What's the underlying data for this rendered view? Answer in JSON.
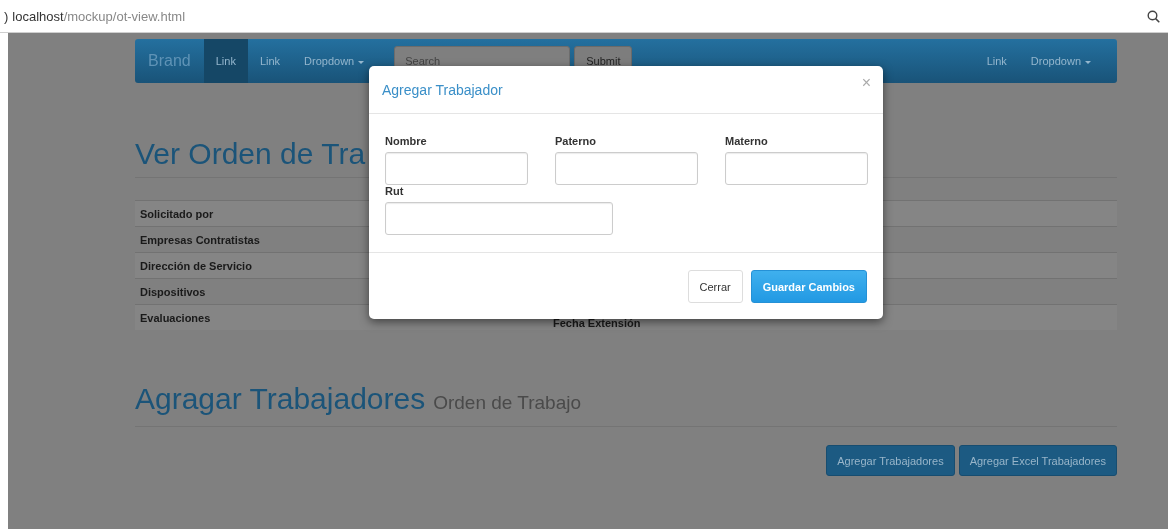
{
  "browser": {
    "url_prefix": ")",
    "url_host": "localhost",
    "url_path": "/mockup/ot-view.html"
  },
  "navbar": {
    "brand": "Brand",
    "items": [
      {
        "label": "Link",
        "kind": "link",
        "selected": true
      },
      {
        "label": "Link",
        "kind": "link",
        "selected": false
      },
      {
        "label": "Dropdown",
        "kind": "dropdown",
        "selected": false
      }
    ],
    "search": {
      "placeholder": "Search"
    },
    "submit": "Submit",
    "right_items": [
      {
        "label": "Link",
        "kind": "link",
        "selected": false
      },
      {
        "label": "Dropdown",
        "kind": "dropdown",
        "selected": false
      }
    ]
  },
  "heading": "Ver Orden de Tra",
  "table": {
    "rows": [
      {
        "label": "Solicitado por"
      },
      {
        "label": "Empresas Contratistas"
      },
      {
        "label": "Dirección de Servicio"
      },
      {
        "label": "Dispositivos"
      },
      {
        "label": "Evaluaciones",
        "value": "Fecha Extensión"
      }
    ]
  },
  "section": {
    "title": "Agragar Trabajadores",
    "subtitle": "Orden de Trabajo"
  },
  "actions": [
    "Agregar Trabajadores",
    "Agregar Excel Trabajadores"
  ],
  "modal": {
    "title": "Agregar Trabajador",
    "close": "×",
    "fields": [
      {
        "label": "Nombre",
        "wide": false
      },
      {
        "label": "Paterno",
        "wide": false
      },
      {
        "label": "Materno",
        "wide": false
      },
      {
        "label": "Rut",
        "wide": true
      }
    ],
    "buttons": [
      {
        "label": "Cerrar",
        "kind": "default"
      },
      {
        "label": "Guardar Cambios",
        "kind": "primary"
      }
    ]
  }
}
